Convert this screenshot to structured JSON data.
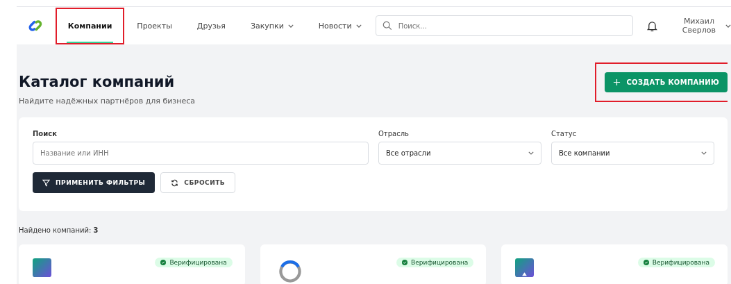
{
  "nav": {
    "tabs": [
      {
        "label": "Компании",
        "selected": true,
        "highlighted": true,
        "dropdown": false
      },
      {
        "label": "Проекты",
        "selected": false,
        "highlighted": false,
        "dropdown": false
      },
      {
        "label": "Друзья",
        "selected": false,
        "highlighted": false,
        "dropdown": false
      },
      {
        "label": "Закупки",
        "selected": false,
        "highlighted": false,
        "dropdown": true
      },
      {
        "label": "Новости",
        "selected": false,
        "highlighted": false,
        "dropdown": true
      }
    ],
    "search": {
      "placeholder": "Поиск..."
    },
    "user": {
      "first_name": "Михаил",
      "last_name": "Сверлов"
    }
  },
  "header": {
    "title": "Каталог компаний",
    "subtitle": "Найдите надёжных партнёров для бизнеса",
    "create_button": {
      "label": "СОЗДАТЬ КОМПАНИЮ",
      "highlighted": true
    }
  },
  "filters": {
    "search": {
      "label": "Поиск",
      "placeholder": "Название или ИНН"
    },
    "selects": [
      {
        "label": "Отрасль",
        "value": "Все отрасли"
      },
      {
        "label": "Статус",
        "value": "Все компании"
      }
    ],
    "apply_button": "ПРИМЕНИТЬ ФИЛЬТРЫ",
    "reset_button": "СБРОСИТЬ"
  },
  "result_count": "Найдено компаний: **3**",
  "companies": [
    {
      "kind": "square",
      "badge": "Верифицирована"
    },
    {
      "kind": "ring",
      "badge": "Верифицирована"
    },
    {
      "kind": "triangle",
      "badge": "Верифицирована"
    }
  ]
}
